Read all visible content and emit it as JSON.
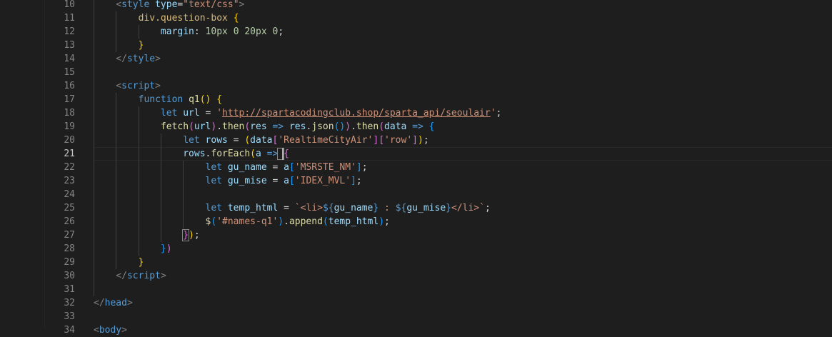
{
  "editor": {
    "active_line": 21,
    "line_numbers": [
      "10",
      "11",
      "12",
      "13",
      "14",
      "15",
      "16",
      "17",
      "18",
      "19",
      "20",
      "21",
      "22",
      "23",
      "24",
      "25",
      "26",
      "27",
      "28",
      "29",
      "30",
      "31",
      "32",
      "33",
      "34"
    ],
    "lines": [
      [
        [
          "t-punct",
          "    <"
        ],
        [
          "t-tag",
          "style"
        ],
        [
          "t-plain",
          " "
        ],
        [
          "t-attr",
          "type"
        ],
        [
          "t-plain",
          "="
        ],
        [
          "t-str",
          "\"text/css\""
        ],
        [
          "t-punct",
          ">"
        ]
      ],
      [
        [
          "t-plain",
          "        "
        ],
        [
          "t-sel",
          "div.question-box"
        ],
        [
          "t-plain",
          " "
        ],
        [
          "t-brace1",
          "{"
        ]
      ],
      [
        [
          "t-plain",
          "            "
        ],
        [
          "t-prop",
          "margin"
        ],
        [
          "t-plain",
          ": "
        ],
        [
          "t-num",
          "10px"
        ],
        [
          "t-plain",
          " "
        ],
        [
          "t-num",
          "0"
        ],
        [
          "t-plain",
          " "
        ],
        [
          "t-num",
          "20px"
        ],
        [
          "t-plain",
          " "
        ],
        [
          "t-num",
          "0"
        ],
        [
          "t-plain",
          ";"
        ]
      ],
      [
        [
          "t-plain",
          "        "
        ],
        [
          "t-brace1",
          "}"
        ]
      ],
      [
        [
          "t-punct",
          "    </"
        ],
        [
          "t-tag",
          "style"
        ],
        [
          "t-punct",
          ">"
        ]
      ],
      [],
      [
        [
          "t-punct",
          "    <"
        ],
        [
          "t-tag",
          "script"
        ],
        [
          "t-punct",
          ">"
        ]
      ],
      [
        [
          "t-plain",
          "        "
        ],
        [
          "t-kw",
          "function"
        ],
        [
          "t-plain",
          " "
        ],
        [
          "t-fn",
          "q1"
        ],
        [
          "t-brace1",
          "()"
        ],
        [
          "t-plain",
          " "
        ],
        [
          "t-brace1",
          "{"
        ]
      ],
      [
        [
          "t-plain",
          "            "
        ],
        [
          "t-kw",
          "let"
        ],
        [
          "t-plain",
          " "
        ],
        [
          "t-var",
          "url"
        ],
        [
          "t-plain",
          " = "
        ],
        [
          "t-str",
          "'"
        ],
        [
          "t-url",
          "http://spartacodingclub.shop/sparta_api/seoulair"
        ],
        [
          "t-str",
          "'"
        ],
        [
          "t-plain",
          ";"
        ]
      ],
      [
        [
          "t-plain",
          "            "
        ],
        [
          "t-fn",
          "fetch"
        ],
        [
          "t-brace2",
          "("
        ],
        [
          "t-var",
          "url"
        ],
        [
          "t-brace2",
          ")"
        ],
        [
          "t-plain",
          "."
        ],
        [
          "t-fn",
          "then"
        ],
        [
          "t-brace2",
          "("
        ],
        [
          "t-var",
          "res"
        ],
        [
          "t-plain",
          " "
        ],
        [
          "t-kw",
          "=>"
        ],
        [
          "t-plain",
          " "
        ],
        [
          "t-var",
          "res"
        ],
        [
          "t-plain",
          "."
        ],
        [
          "t-fn",
          "json"
        ],
        [
          "t-brace3",
          "()"
        ],
        [
          "t-brace2",
          ")"
        ],
        [
          "t-plain",
          "."
        ],
        [
          "t-fn",
          "then"
        ],
        [
          "t-brace2",
          "("
        ],
        [
          "t-var",
          "data"
        ],
        [
          "t-plain",
          " "
        ],
        [
          "t-kw",
          "=>"
        ],
        [
          "t-plain",
          " "
        ],
        [
          "t-brace3",
          "{"
        ]
      ],
      [
        [
          "t-plain",
          "                "
        ],
        [
          "t-kw",
          "let"
        ],
        [
          "t-plain",
          " "
        ],
        [
          "t-var",
          "rows"
        ],
        [
          "t-plain",
          " = "
        ],
        [
          "t-brace1",
          "("
        ],
        [
          "t-var",
          "data"
        ],
        [
          "t-brace2",
          "["
        ],
        [
          "t-str",
          "'RealtimeCityAir'"
        ],
        [
          "t-brace2",
          "]["
        ],
        [
          "t-str",
          "'row'"
        ],
        [
          "t-brace2",
          "]"
        ],
        [
          "t-brace1",
          ")"
        ],
        [
          "t-plain",
          ";"
        ]
      ],
      [
        [
          "t-plain",
          "                "
        ],
        [
          "t-var",
          "rows"
        ],
        [
          "t-plain",
          "."
        ],
        [
          "t-fn",
          "forEach"
        ],
        [
          "t-brace1",
          "("
        ],
        [
          "t-var",
          "a"
        ],
        [
          "t-plain",
          " "
        ],
        [
          "t-kw",
          "=>"
        ],
        [
          "t-plain",
          " "
        ],
        [
          "t-brace2",
          "{"
        ]
      ],
      [
        [
          "t-plain",
          "                    "
        ],
        [
          "t-kw",
          "let"
        ],
        [
          "t-plain",
          " "
        ],
        [
          "t-var",
          "gu_name"
        ],
        [
          "t-plain",
          " = "
        ],
        [
          "t-var",
          "a"
        ],
        [
          "t-brace3",
          "["
        ],
        [
          "t-str",
          "'MSRSTE_NM'"
        ],
        [
          "t-brace3",
          "]"
        ],
        [
          "t-plain",
          ";"
        ]
      ],
      [
        [
          "t-plain",
          "                    "
        ],
        [
          "t-kw",
          "let"
        ],
        [
          "t-plain",
          " "
        ],
        [
          "t-var",
          "gu_mise"
        ],
        [
          "t-plain",
          " = "
        ],
        [
          "t-var",
          "a"
        ],
        [
          "t-brace3",
          "["
        ],
        [
          "t-str",
          "'IDEX_MVL'"
        ],
        [
          "t-brace3",
          "]"
        ],
        [
          "t-plain",
          ";"
        ]
      ],
      [],
      [
        [
          "t-plain",
          "                    "
        ],
        [
          "t-kw",
          "let"
        ],
        [
          "t-plain",
          " "
        ],
        [
          "t-var",
          "temp_html"
        ],
        [
          "t-plain",
          " = "
        ],
        [
          "t-str",
          "`<li>"
        ],
        [
          "t-kw",
          "${"
        ],
        [
          "t-var",
          "gu_name"
        ],
        [
          "t-kw",
          "}"
        ],
        [
          "t-str",
          " : "
        ],
        [
          "t-kw",
          "${"
        ],
        [
          "t-var",
          "gu_mise"
        ],
        [
          "t-kw",
          "}"
        ],
        [
          "t-str",
          "</li>`"
        ],
        [
          "t-plain",
          ";"
        ]
      ],
      [
        [
          "t-plain",
          "                    "
        ],
        [
          "t-fn",
          "$"
        ],
        [
          "t-brace3",
          "("
        ],
        [
          "t-str",
          "'#names-q1'"
        ],
        [
          "t-brace3",
          ")"
        ],
        [
          "t-plain",
          "."
        ],
        [
          "t-fn",
          "append"
        ],
        [
          "t-brace3",
          "("
        ],
        [
          "t-var",
          "temp_html"
        ],
        [
          "t-brace3",
          ")"
        ],
        [
          "t-plain",
          ";"
        ]
      ],
      [
        [
          "t-plain",
          "                "
        ],
        [
          "t-brace2",
          "}"
        ],
        [
          "t-brace1",
          ")"
        ],
        [
          "t-plain",
          ";"
        ]
      ],
      [
        [
          "t-plain",
          "            "
        ],
        [
          "t-brace3",
          "}"
        ],
        [
          "t-brace2",
          ")"
        ]
      ],
      [
        [
          "t-plain",
          "        "
        ],
        [
          "t-brace1",
          "}"
        ]
      ],
      [
        [
          "t-punct",
          "    </"
        ],
        [
          "t-tag",
          "script"
        ],
        [
          "t-punct",
          ">"
        ]
      ],
      [],
      [
        [
          "t-punct",
          "</"
        ],
        [
          "t-tag",
          "head"
        ],
        [
          "t-punct",
          ">"
        ]
      ],
      [],
      [
        [
          "t-punct",
          "<"
        ],
        [
          "t-tag",
          "body"
        ],
        [
          "t-punct",
          ">"
        ]
      ]
    ]
  }
}
